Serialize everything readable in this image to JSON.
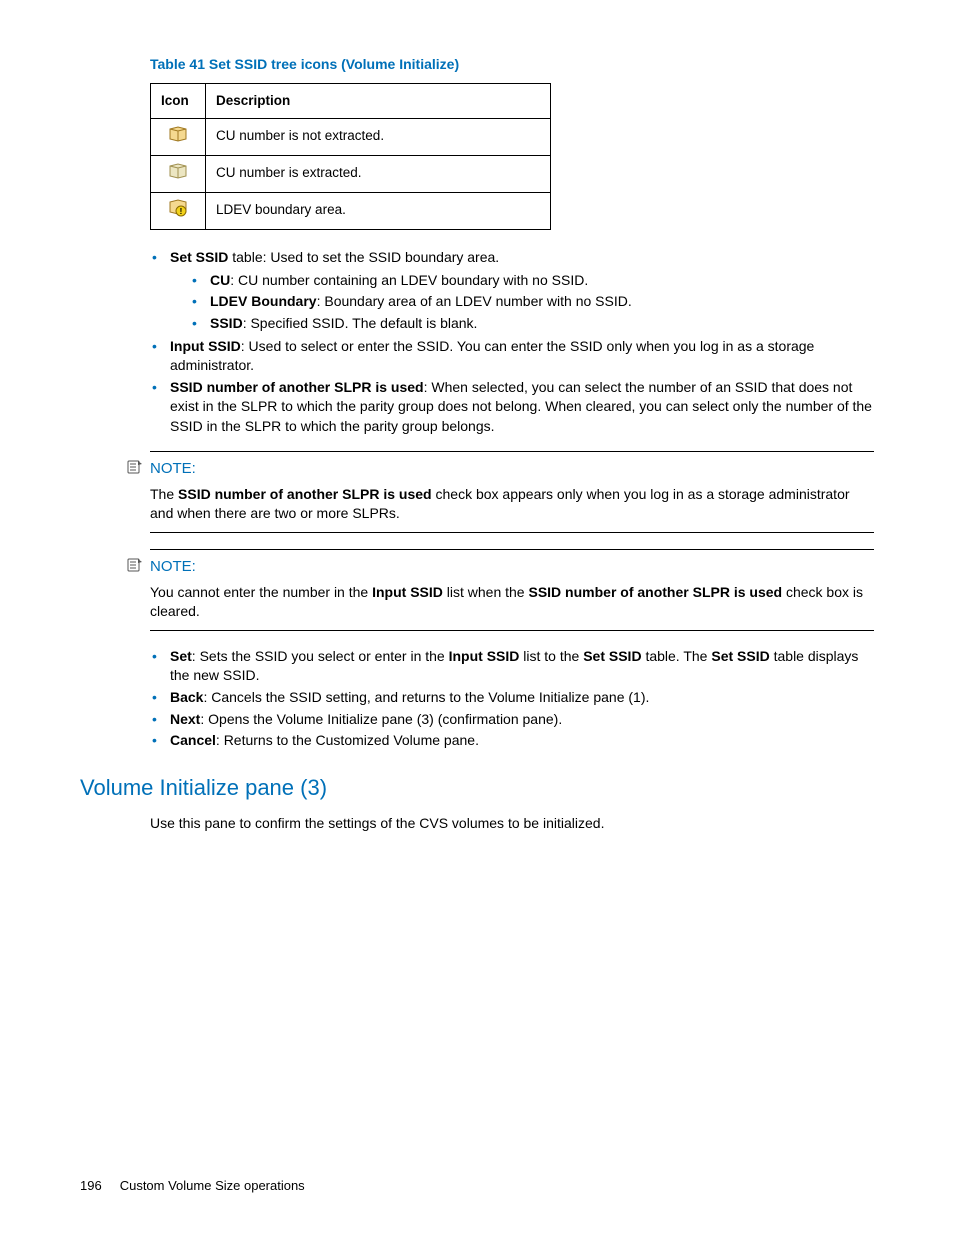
{
  "table": {
    "caption": "Table 41 Set SSID tree icons (Volume Initialize)",
    "headers": {
      "icon": "Icon",
      "desc": "Description"
    },
    "rows": [
      {
        "desc": "CU number is not extracted."
      },
      {
        "desc": "CU number is extracted."
      },
      {
        "desc": "LDEV boundary area."
      }
    ]
  },
  "bullets1": {
    "setSsid": {
      "label": "Set SSID",
      "rest": " table: Used to set the SSID boundary area."
    },
    "cu": {
      "label": "CU",
      "rest": ": CU number containing an LDEV boundary with no SSID."
    },
    "ldevBoundary": {
      "label": "LDEV Boundary",
      "rest": ": Boundary area of an LDEV number with no SSID."
    },
    "ssid": {
      "label": "SSID",
      "rest": ": Specified SSID. The default is blank."
    },
    "inputSsid": {
      "label": "Input SSID",
      "rest": ": Used to select or enter the SSID. You can enter the SSID only when you log in as a storage administrator."
    },
    "slpr": {
      "label": "SSID number of another SLPR is used",
      "rest": ": When selected, you can select the number of an SSID that does not exist in the SLPR to which the parity group does not belong. When cleared, you can select only the number of the SSID in the SLPR to which the parity group belongs."
    }
  },
  "note1": {
    "title": "NOTE:",
    "pre": "The ",
    "bold": "SSID number of another SLPR is used",
    "post": " check box appears only when you log in as a storage administrator and when there are two or more SLPRs."
  },
  "note2": {
    "title": "NOTE:",
    "pre": "You cannot enter the number in the ",
    "bold1": "Input SSID",
    "mid": " list when the ",
    "bold2": "SSID number of another SLPR is used",
    "post": " check box is cleared."
  },
  "bullets2": {
    "set": {
      "label": "Set",
      "p1": ": Sets the SSID you select or enter in the ",
      "b1": "Input SSID",
      "p2": " list to the ",
      "b2": "Set SSID",
      "p3": " table. The ",
      "b3": "Set SSID",
      "p4": " table displays the new SSID."
    },
    "back": {
      "label": "Back",
      "rest": ": Cancels the SSID setting, and returns to the Volume Initialize pane (1)."
    },
    "next": {
      "label": "Next",
      "rest": ": Opens the Volume Initialize pane (3) (confirmation pane)."
    },
    "cancel": {
      "label": "Cancel",
      "rest": ": Returns to the Customized Volume pane."
    }
  },
  "section": {
    "heading": "Volume Initialize pane (3)",
    "intro": "Use this pane to confirm the settings of the CVS volumes to be initialized."
  },
  "footer": {
    "page": "196",
    "title": "Custom Volume Size operations"
  }
}
